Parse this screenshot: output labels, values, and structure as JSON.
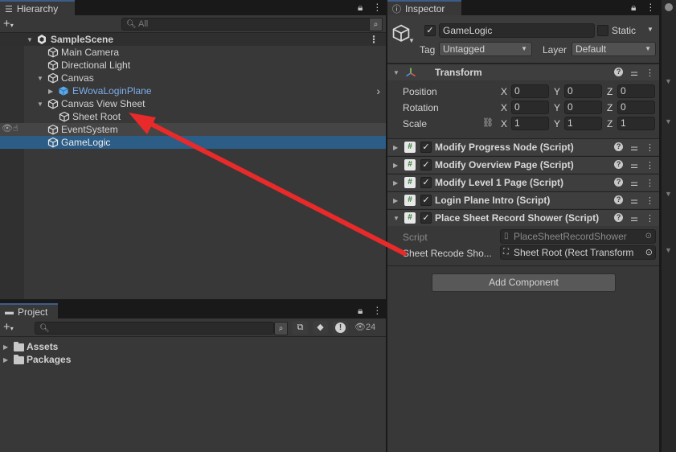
{
  "hierarchy": {
    "tab_label": "Hierarchy",
    "tab_icon": "list-icon",
    "search_placeholder": "All",
    "scene_name": "SampleScene",
    "items": [
      {
        "label": "Main Camera"
      },
      {
        "label": "Directional Light"
      },
      {
        "label": "Canvas"
      },
      {
        "label": "EWovaLoginPlane"
      },
      {
        "label": "Canvas View Sheet"
      },
      {
        "label": "Sheet Root"
      },
      {
        "label": "EventSystem"
      },
      {
        "label": "GameLogic"
      }
    ],
    "selected_item": "GameLogic",
    "prefab_color": "#7cadeb",
    "selection_color": "#2c5d87"
  },
  "project": {
    "tab_label": "Project",
    "tab_icon": "folder-icon",
    "hidden_count": "24",
    "folders": [
      {
        "label": "Assets"
      },
      {
        "label": "Packages"
      }
    ]
  },
  "inspector": {
    "tab_label": "Inspector",
    "tab_icon": "info-icon",
    "object_name": "GameLogic",
    "static_label": "Static",
    "tag_label": "Tag",
    "tag_value": "Untagged",
    "layer_label": "Layer",
    "layer_value": "Default",
    "transform": {
      "title": "Transform",
      "position_label": "Position",
      "rotation_label": "Rotation",
      "scale_label": "Scale",
      "axis_x": "X",
      "axis_y": "Y",
      "axis_z": "Z",
      "position": [
        "0",
        "0",
        "0"
      ],
      "rotation": [
        "0",
        "0",
        "0"
      ],
      "scale": [
        "1",
        "1",
        "1"
      ]
    },
    "components": [
      {
        "title": "Modify Progress Node (Script)"
      },
      {
        "title": "Modify Overview Page (Script)"
      },
      {
        "title": "Modify Level 1 Page (Script)"
      },
      {
        "title": "Login Plane Intro (Script)"
      },
      {
        "title": "Place Sheet Record Shower (Script)"
      }
    ],
    "script_label": "Script",
    "script_value": "PlaceSheetRecordShower",
    "sheet_field_label": "Sheet Recode Sho...",
    "sheet_field_value": "Sheet Root (Rect Transform",
    "add_component_label": "Add Component"
  },
  "annotation": {
    "arrow_color": "#e82a2a"
  }
}
